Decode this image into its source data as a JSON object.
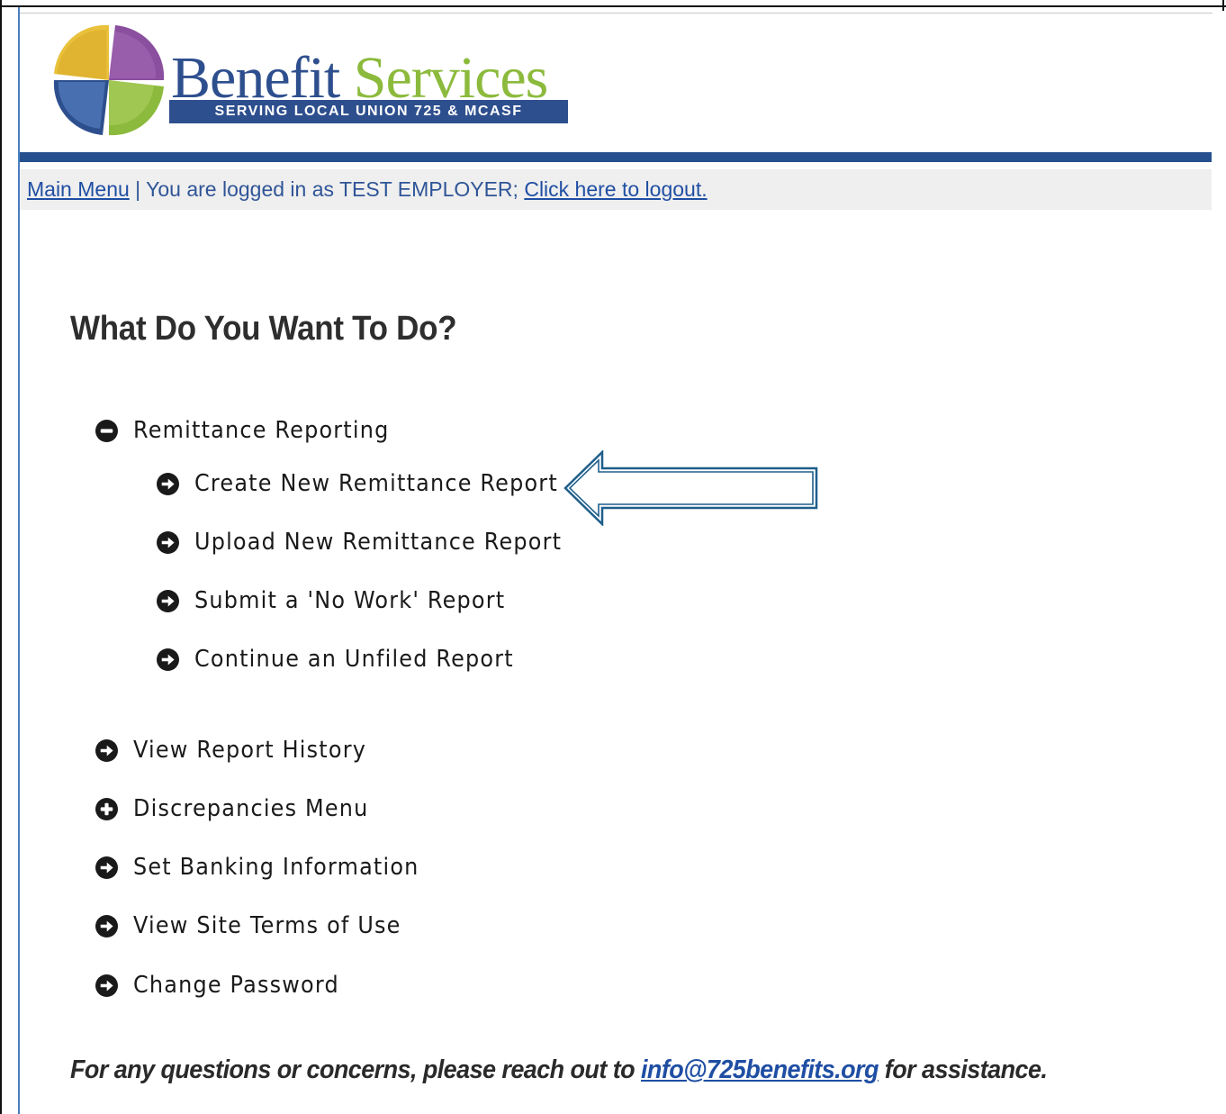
{
  "brand": {
    "word1": "Benefit",
    "word2": "Services",
    "tagline": "SERVING LOCAL UNION 725 & MCASF",
    "colors": {
      "blue": "#2e4f8e",
      "green": "#8cba3c",
      "purple": "#8a4f9e",
      "yellow": "#e9c13b",
      "lightblue": "#5a87c6"
    }
  },
  "topbar": {
    "main_menu": "Main Menu",
    "separator": " | ",
    "logged_in_text": "You are logged in as TEST EMPLOYER; ",
    "logout": "Click here to logout."
  },
  "main": {
    "heading": "What Do You Want To Do?",
    "menu": [
      {
        "label": "Remittance Reporting",
        "icon": "minus-circle-icon"
      },
      {
        "label": "Create New Remittance Report",
        "icon": "arrow-circle-right-icon",
        "highlighted": true
      },
      {
        "label": "Upload New Remittance Report",
        "icon": "arrow-circle-right-icon"
      },
      {
        "label": "Submit a 'No Work' Report",
        "icon": "arrow-circle-right-icon"
      },
      {
        "label": "Continue an Unfiled Report",
        "icon": "arrow-circle-right-icon"
      },
      {
        "label": "View Report History",
        "icon": "arrow-circle-right-icon"
      },
      {
        "label": "Discrepancies Menu",
        "icon": "plus-circle-icon"
      },
      {
        "label": "Set Banking Information",
        "icon": "arrow-circle-right-icon"
      },
      {
        "label": "View Site Terms of Use",
        "icon": "arrow-circle-right-icon"
      },
      {
        "label": "Change Password",
        "icon": "arrow-circle-right-icon"
      }
    ]
  },
  "footer": {
    "prefix": "For any questions or concerns, please reach out to ",
    "email": "info@725benefits.org",
    "suffix": " for assistance."
  },
  "annotation_color": "#1f5f8b"
}
